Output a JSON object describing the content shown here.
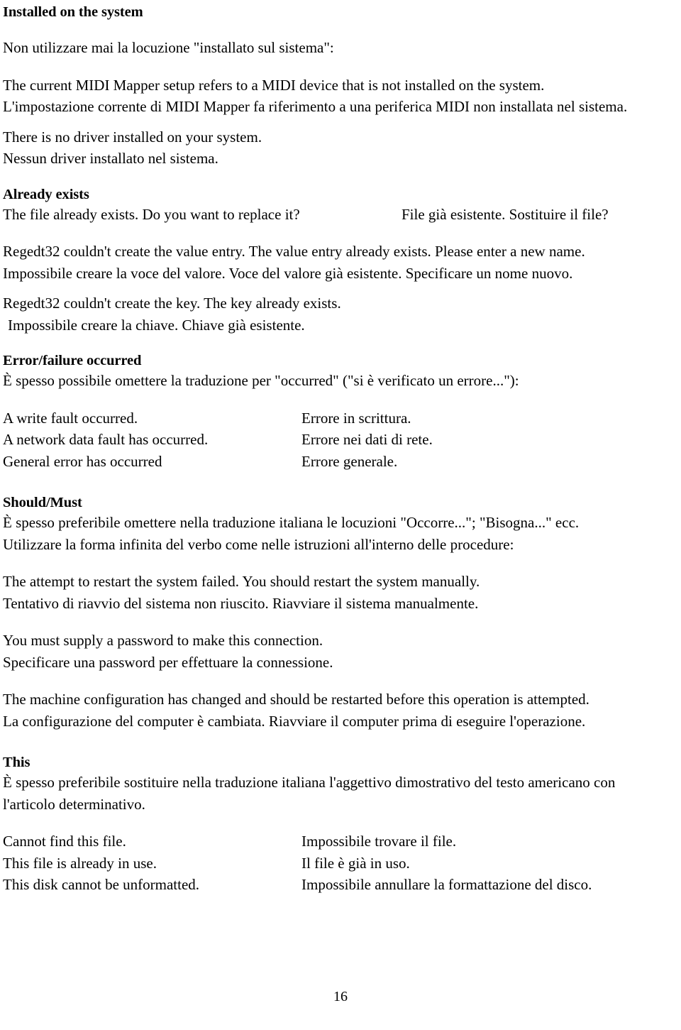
{
  "document": {
    "page_number": "16",
    "sections": [
      {
        "id": "installed-on-the-system",
        "heading": "Installed on the system",
        "intro": "Non utilizzare mai la locuzione \"installato sul sistema\":",
        "block1_en": "The current MIDI Mapper setup refers to a MIDI device that is not installed on the system.",
        "block1_it": "L'impostazione corrente di MIDI Mapper fa riferimento a una periferica MIDI non installata nel sistema.",
        "block2_en": "There is no driver installed on your system.",
        "block2_it": "Nessun driver installato nel sistema."
      },
      {
        "id": "already-exists",
        "heading": "Already exists",
        "pair1_en": "The file already exists. Do you want to replace it?",
        "pair1_it": "File già esistente. Sostituire il file?",
        "block2_en": "Regedt32 couldn't create the value entry. The value entry already exists. Please enter a new name.",
        "block2_it": "Impossibile creare la voce del valore. Voce del valore già esistente. Specificare un nome nuovo.",
        "block3_en": "Regedt32 couldn't create the key. The key already exists.",
        "block3_it": "Impossibile creare la chiave. Chiave già esistente."
      },
      {
        "id": "error-failure-occurred",
        "heading": "Error/failure occurred",
        "intro": "È spesso possibile omettere la traduzione per \"occurred\" (\"si è verificato un errore...\"):",
        "rows": [
          {
            "en": "A write fault occurred.",
            "it": "Errore in scrittura."
          },
          {
            "en": "A network data fault has occurred.",
            "it": "Errore nei dati di rete."
          },
          {
            "en": "General error has occurred",
            "it": "Errore generale."
          }
        ]
      },
      {
        "id": "should-must",
        "heading": "Should/Must",
        "intro_line1": "È spesso preferibile omettere nella traduzione italiana le locuzioni \"Occorre...\"; \"Bisogna...\" ecc.",
        "intro_line2": "Utilizzare la forma infinita del verbo come nelle istruzioni all'interno delle procedure:",
        "block1_en": "The attempt to restart the system failed. You should restart the system manually.",
        "block1_it": "Tentativo di riavvio del sistema non riuscito. Riavviare il sistema manualmente.",
        "block2_en": "You must supply a password to make this connection.",
        "block2_it": "Specificare una password per effettuare la connessione.",
        "block3_en": "The machine configuration has changed and should be restarted before this operation is attempted.",
        "block3_it": "La configurazione del computer è cambiata. Riavviare il computer prima di eseguire l'operazione."
      },
      {
        "id": "this",
        "heading": "This",
        "intro": "È spesso preferibile sostituire nella traduzione italiana l'aggettivo dimostrativo del testo americano con l'articolo determinativo.",
        "rows": [
          {
            "en": "Cannot find this file.",
            "it": "Impossibile trovare il file."
          },
          {
            "en": "This file is already in use.",
            "it": "Il file è già in uso."
          },
          {
            "en": "This disk cannot be unformatted.",
            "it": "Impossibile annullare la formattazione del disco."
          }
        ]
      }
    ]
  }
}
